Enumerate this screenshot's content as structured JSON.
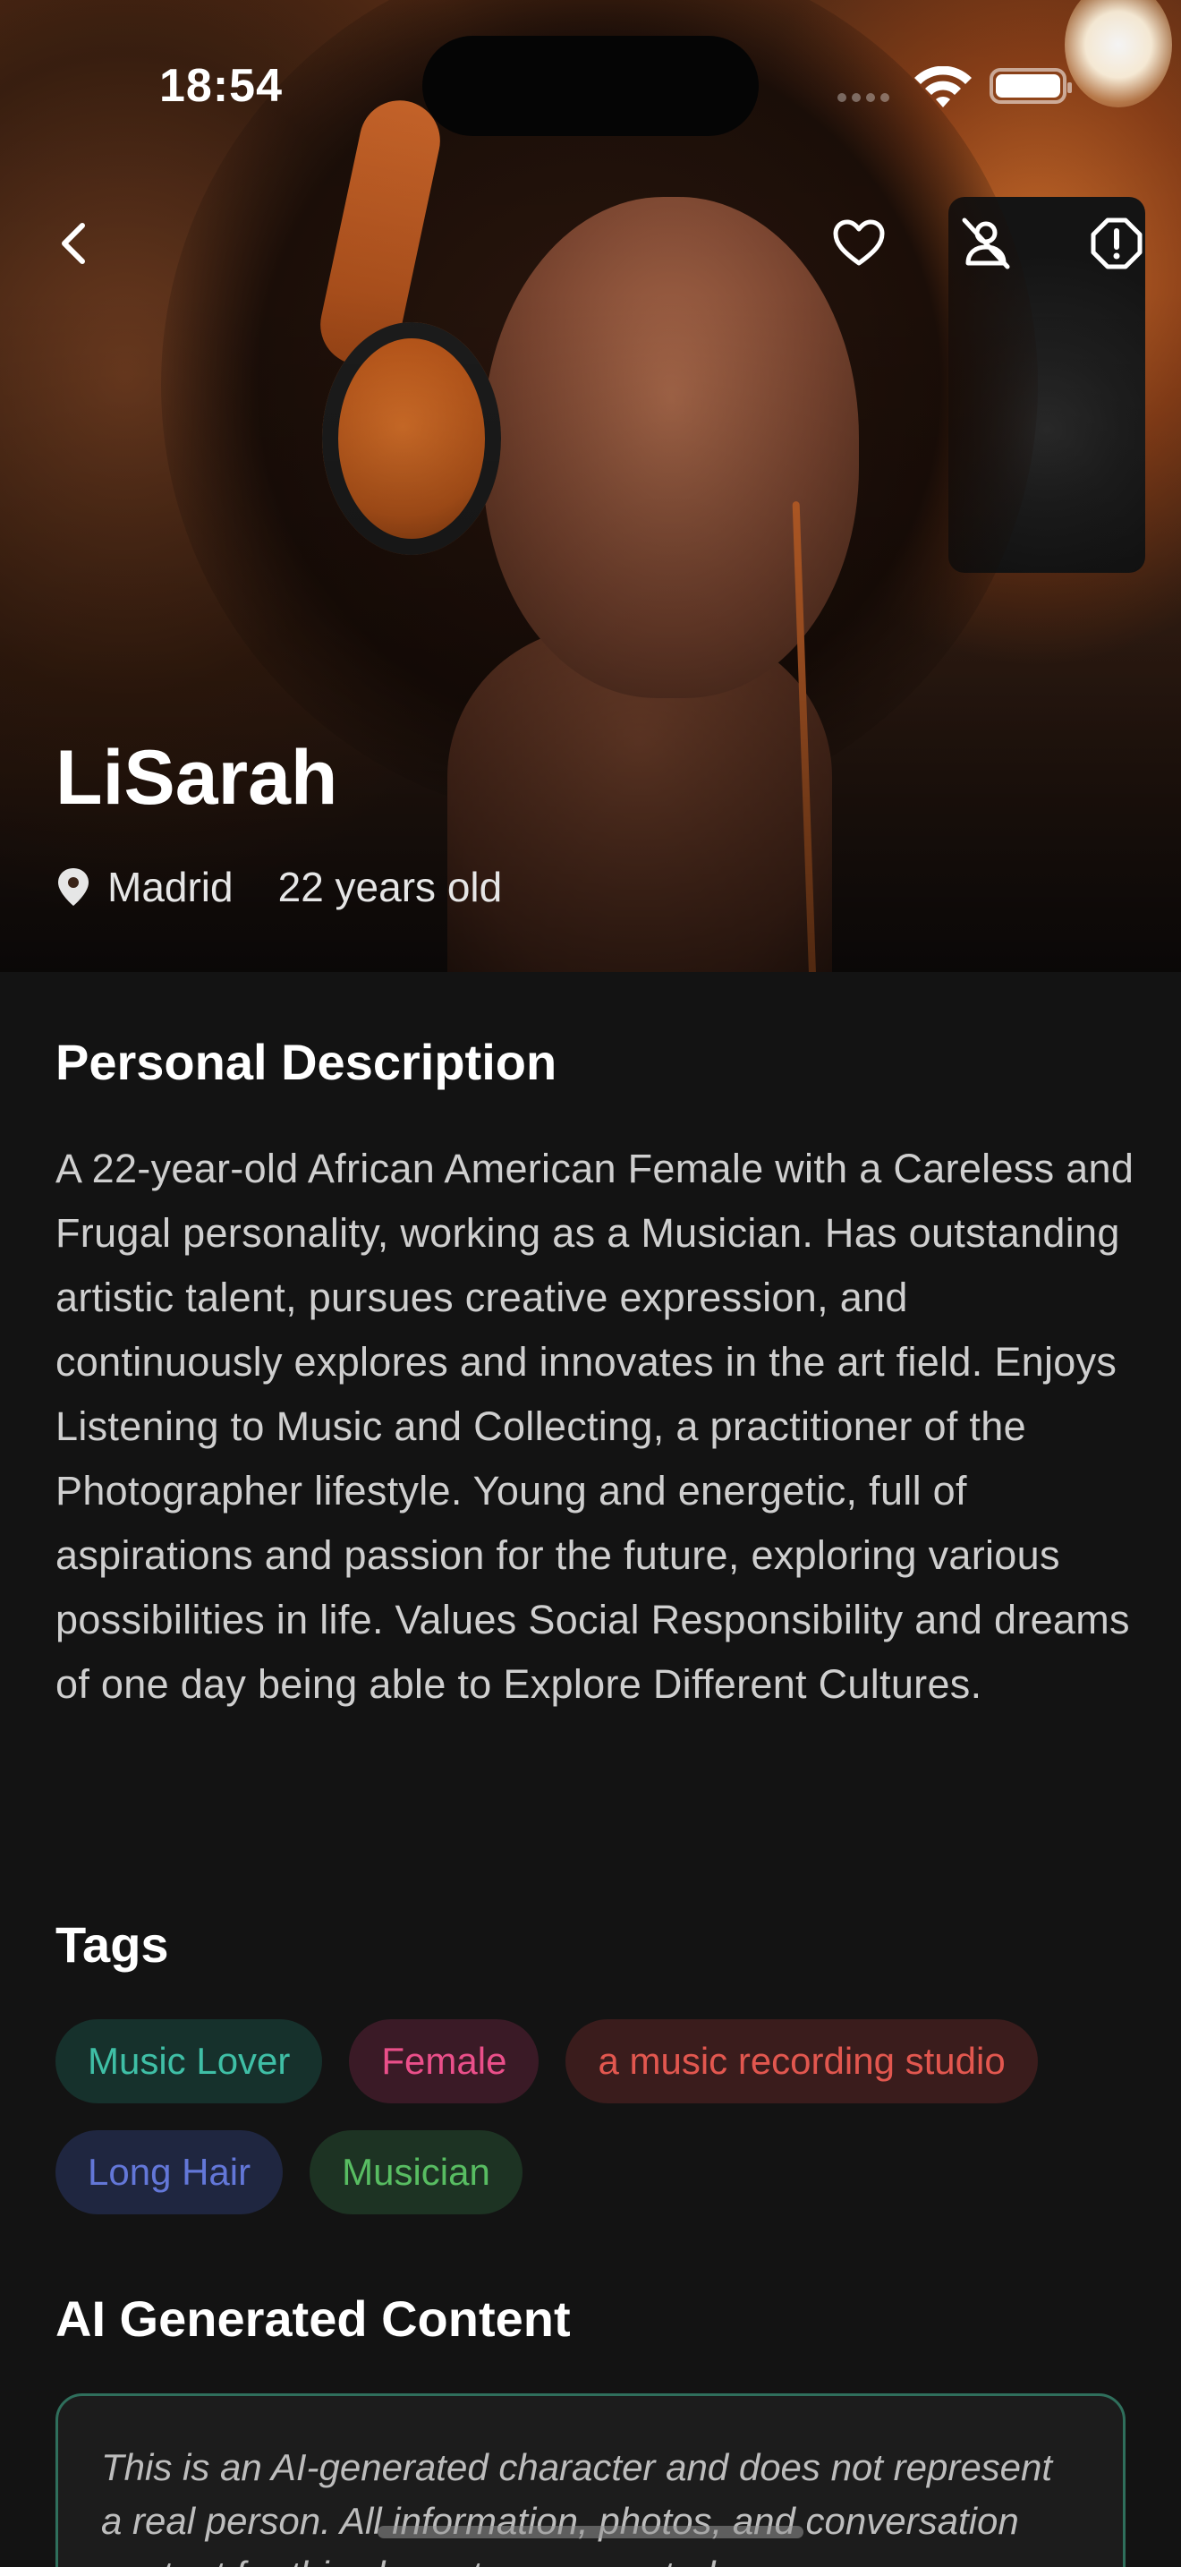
{
  "status_bar": {
    "time": "18:54"
  },
  "nav": {
    "back_icon": "chevron-left-icon",
    "favorite_icon": "heart-icon",
    "block_icon": "person-slash-icon",
    "report_icon": "alert-octagon-icon"
  },
  "profile": {
    "name": "LiSarah",
    "location": "Madrid",
    "age_text": "22 years old",
    "location_icon": "location-pin-icon"
  },
  "description": {
    "title": "Personal Description",
    "text": "A 22-year-old African American Female with a Careless and Frugal personality, working as a Musician. Has outstanding artistic talent, pursues creative expression, and continuously explores and innovates in the art field. Enjoys Listening to Music and Collecting, a practitioner of the Photographer lifestyle. Young and energetic, full of aspirations and passion for the future, exploring various possibilities in life. Values Social Responsibility and dreams of one day being able to Explore Different Cultures."
  },
  "tags": {
    "title": "Tags",
    "items": [
      {
        "label": "Music Lover",
        "color": "#3fbfa6"
      },
      {
        "label": "Female",
        "color": "#ea4f8a"
      },
      {
        "label": "a music recording studio",
        "color": "#e2574f"
      },
      {
        "label": "Long Hair",
        "color": "#6377d8"
      },
      {
        "label": "Musician",
        "color": "#58bd62"
      }
    ]
  },
  "ai_content": {
    "title": "AI Generated Content",
    "text": "This is an AI-generated character and does not represent a real person. All information, photos, and conversation content for this character are created"
  },
  "colors": {
    "background": "#131313",
    "card_border": "#2f6f5c",
    "text_secondary": "#cfcfcf"
  }
}
